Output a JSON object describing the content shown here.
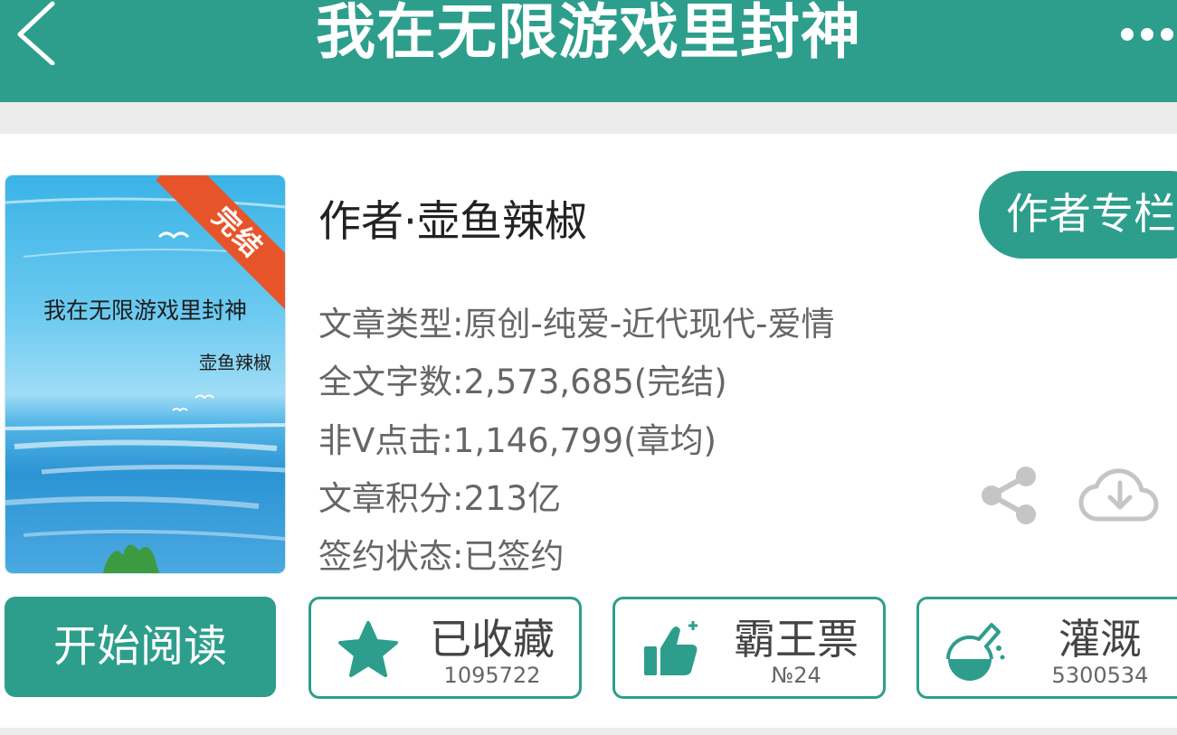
{
  "header": {
    "title": "我在无限游戏里封神",
    "back_icon": "chevron-left-icon",
    "more_icon": "more-dots-icon",
    "color": "#2d9e8c"
  },
  "book": {
    "cover": {
      "title": "我在无限游戏里封神",
      "author": "壶鱼辣椒",
      "ribbon": "完结",
      "ribbon_color": "#e8542a"
    },
    "author_line": "作者·壶鱼辣椒",
    "author_column_button": "作者专栏",
    "info": [
      "文章类型:原创-纯爱-近代现代-爱情",
      "全文字数:2,573,685(完结)",
      "非V点击:1,146,799(章均)",
      "文章积分:213亿",
      "签约状态:已签约"
    ],
    "share_icon": "share-icon",
    "download_icon": "cloud-download-icon"
  },
  "actions": {
    "start_reading": "开始阅读",
    "buttons": [
      {
        "label": "已收藏",
        "count": "1095722",
        "icon": "star-icon"
      },
      {
        "label": "霸王票",
        "count": "№24",
        "icon": "thumbs-up-icon"
      },
      {
        "label": "灌溉",
        "count": "5300534",
        "icon": "flask-icon"
      }
    ]
  }
}
